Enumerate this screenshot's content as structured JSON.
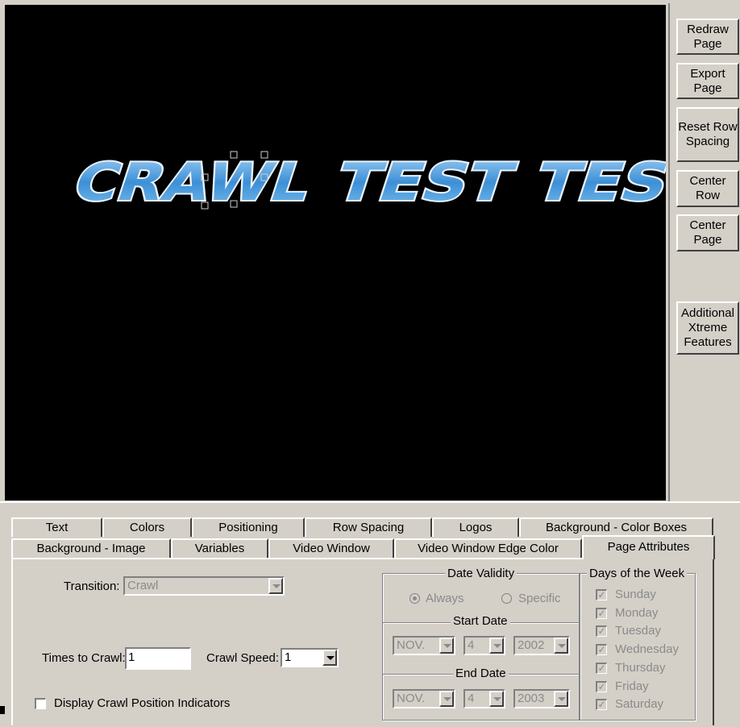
{
  "canvas": {
    "words": [
      "CRAWL",
      "TEST",
      "TEST"
    ]
  },
  "sidebar": {
    "buttons": [
      {
        "label": "Redraw Page"
      },
      {
        "label": "Export Page"
      },
      {
        "label": "Reset Row Spacing"
      },
      {
        "label": "Center Row"
      },
      {
        "label": "Center Page"
      },
      {
        "label": "Additional Xtreme Features"
      }
    ]
  },
  "tabs": {
    "row1": [
      "Text",
      "Colors",
      "Positioning",
      "Row Spacing",
      "Logos",
      "Background - Color Boxes"
    ],
    "row2": [
      "Background - Image",
      "Variables",
      "Video Window",
      "Video Window Edge Color",
      "Page Attributes"
    ],
    "active": "Page Attributes"
  },
  "page_attributes": {
    "transition_label": "Transition:",
    "transition_value": "Crawl",
    "times_label": "Times to Crawl:",
    "times_value": "1",
    "speed_label": "Crawl Speed:",
    "speed_value": "1",
    "display_indicators_label": "Display Crawl Position Indicators",
    "display_indicators_checked": false
  },
  "date_validity": {
    "title": "Date Validity",
    "always_label": "Always",
    "specific_label": "Specific",
    "selected": "Always",
    "start_title": "Start Date",
    "start_month": "NOV.",
    "start_day": "4",
    "start_year": "2002",
    "end_title": "End Date",
    "end_month": "NOV.",
    "end_day": "4",
    "end_year": "2003"
  },
  "days": {
    "title": "Days of the Week",
    "items": [
      {
        "label": "Sunday",
        "checked": true
      },
      {
        "label": "Monday",
        "checked": true
      },
      {
        "label": "Tuesday",
        "checked": true
      },
      {
        "label": "Wednesday",
        "checked": true
      },
      {
        "label": "Thursday",
        "checked": true
      },
      {
        "label": "Friday",
        "checked": true
      },
      {
        "label": "Saturday",
        "checked": true
      }
    ]
  },
  "colors": {
    "canvas_bg": "#000000",
    "text_fill": "#5aa6e0",
    "text_outline": "#e8f2ff",
    "window_bg": "#d4d0c8",
    "disabled_text": "#8a8a8a"
  }
}
